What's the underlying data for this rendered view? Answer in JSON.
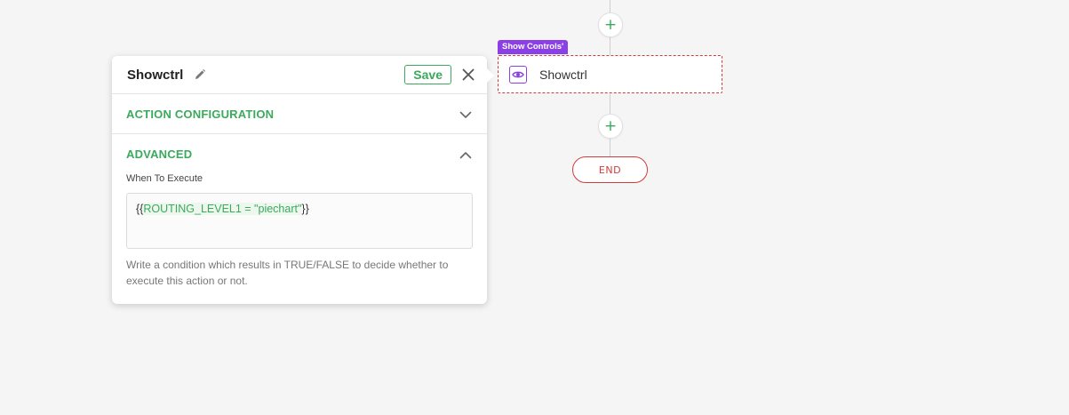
{
  "flow": {
    "node_tag": "Show Controls'",
    "node_label": "Showctrl",
    "end_label": "END",
    "add_symbol": "+"
  },
  "panel": {
    "title": "Showctrl",
    "save_label": "Save",
    "sections": {
      "action_configuration": "ACTION CONFIGURATION",
      "advanced": "ADVANCED"
    },
    "advanced": {
      "field_label": "When To Execute",
      "expression_open": "{{",
      "expression_body": "ROUTING_LEVEL1 = \"piechart\"",
      "expression_close": "}}",
      "help_text": "Write a condition which results in TRUE/FALSE to decide whether to execute this action or not."
    }
  },
  "colors": {
    "accent_green": "#3aaa5c",
    "node_purple": "#8b3fe6",
    "error_red": "#d23b3b",
    "background": "#f5f5f5"
  },
  "icons": {
    "edit": "pencil-icon",
    "close": "close-icon",
    "collapse": "chevron-down-icon",
    "expand": "chevron-up-icon",
    "node": "eye-icon",
    "add": "plus-icon"
  }
}
